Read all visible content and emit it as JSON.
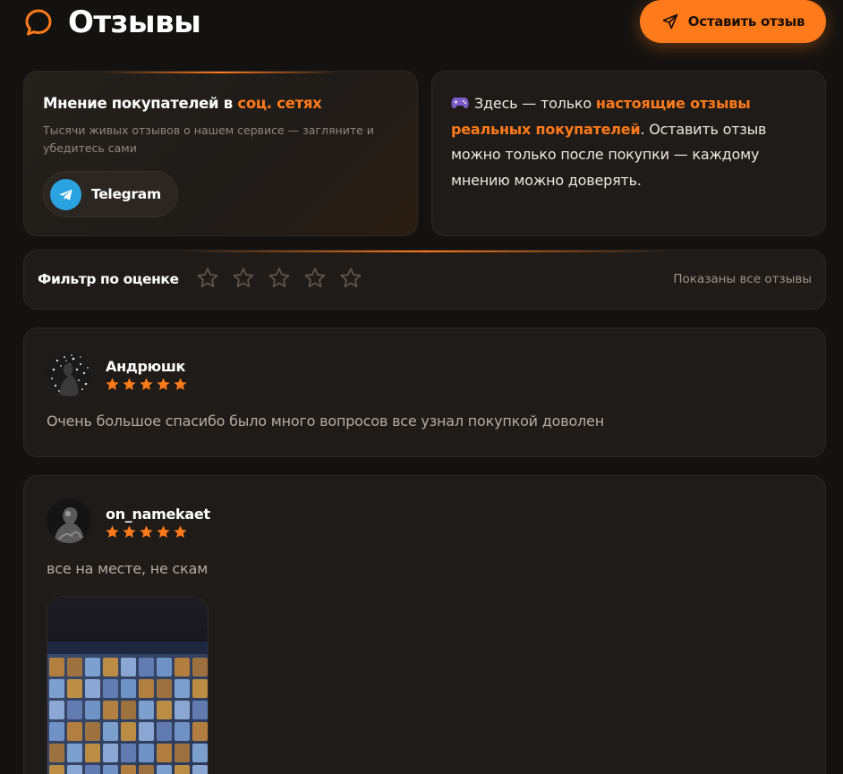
{
  "header": {
    "title": "Отзывы",
    "leave_review_label": "Оставить отзыв"
  },
  "social": {
    "title_prefix": "Мнение покупателей в ",
    "title_accent": "соц. сетях",
    "subtitle": "Тысячи живых отзывов о нашем сервисе — загляните и убедитесь сами",
    "telegram_label": "Telegram"
  },
  "info": {
    "text_prefix": "Здесь — только ",
    "text_accent": "настоящие отзывы реальных покупателей",
    "text_suffix": ". Оставить отзыв можно только после покупки — каждому мнению можно доверять."
  },
  "filter": {
    "label": "Фильтр по оценке",
    "stars": 5,
    "status": "Показаны все отзывы"
  },
  "reviews": [
    {
      "name": "Андрюшк",
      "rating": 5,
      "text": "Очень большое спасибо было много вопросов все узнал покупкой доволен"
    },
    {
      "name": "on_namekaet",
      "rating": 5,
      "text": "все на месте, не скам",
      "has_photo": true
    }
  ],
  "colors": {
    "accent": "#ff7a1a",
    "background": "#141210",
    "card": "#1f1b18",
    "telegram": "#2aa3e0"
  }
}
